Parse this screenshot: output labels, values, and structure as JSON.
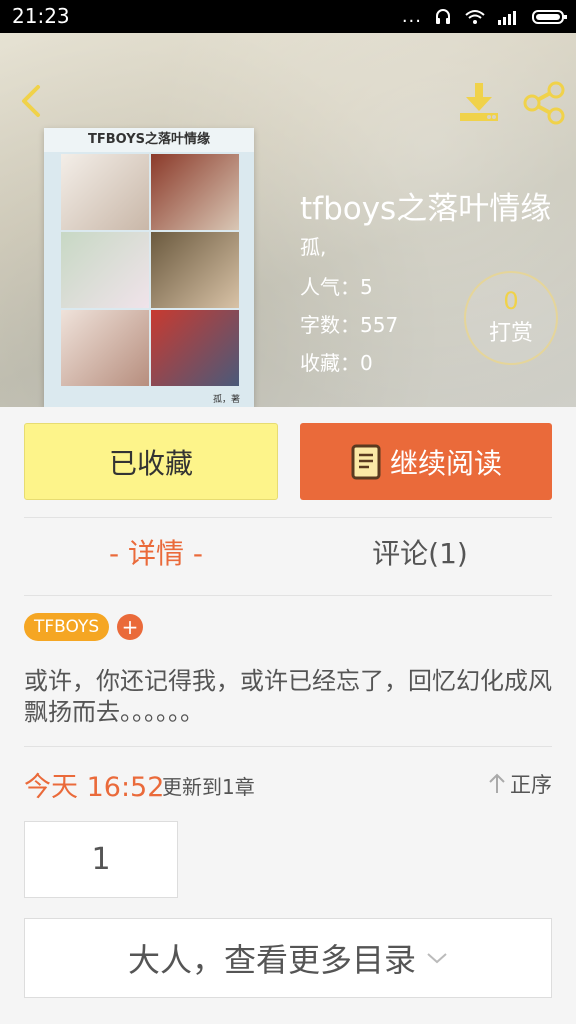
{
  "status_bar": {
    "time": "21:23",
    "dots": "...",
    "icons": [
      "headset-icon",
      "wifi-icon",
      "signal-icon",
      "battery-icon"
    ]
  },
  "header": {
    "icons": [
      "back-icon",
      "download-icon",
      "share-icon"
    ],
    "cover": {
      "title": "TFBOYS之落叶情缘",
      "author": "孤，著"
    },
    "book_title": "tfboys之落叶情缘",
    "author": "孤,",
    "stats": {
      "popularity": "人气：5",
      "word_count": "字数：557",
      "favorites": "收藏：0"
    },
    "tip": {
      "count": "0",
      "label": "打赏"
    }
  },
  "actions": {
    "collected": "已收藏",
    "continue_reading": "继续阅读",
    "colors": {
      "collected_bg": "#fdf48a",
      "read_bg": "#ea6a3a"
    }
  },
  "tabs": {
    "detail": "- 详情 -",
    "comments": "评论(1)"
  },
  "tags": {
    "items": [
      "TFBOYS"
    ],
    "add_symbol": "+"
  },
  "description": "或许，你还记得我，或许已经忘了，回忆幻化成风飘扬而去。。。。。。",
  "update": {
    "date": "今天 16:52",
    "text": "更新到1章",
    "sort": "正序"
  },
  "chapters": {
    "items": [
      "1"
    ]
  },
  "more_catalog": "大人，查看更多目录",
  "accent": "#ea6a3a"
}
